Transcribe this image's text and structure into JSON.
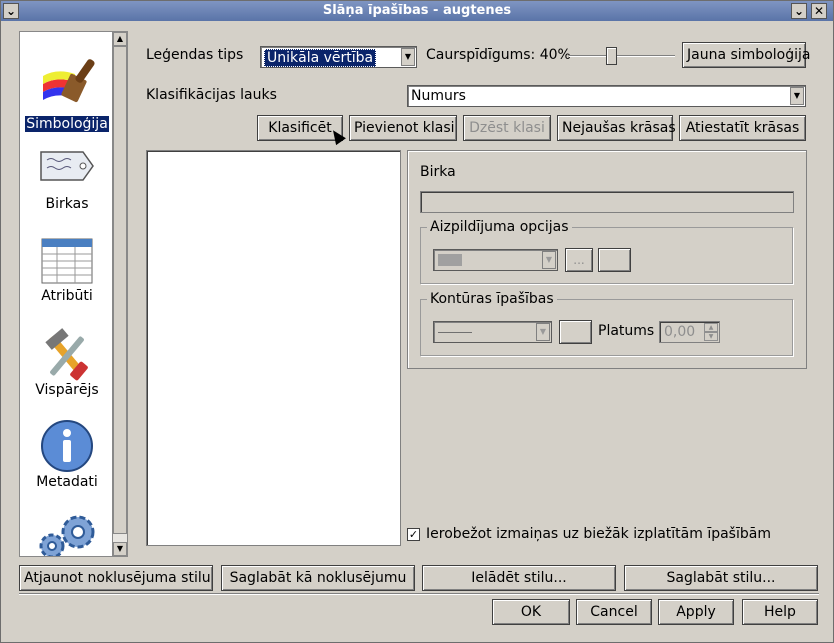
{
  "window": {
    "title": "Slāņa īpašības - augtenes",
    "menu_glyph": "⌄",
    "minimize_glyph": "⌄",
    "close_glyph": "✕"
  },
  "sidebar": {
    "items": [
      {
        "label": "Simboloģija",
        "icon": "paintbrush-icon",
        "selected": true
      },
      {
        "label": "Birkas",
        "icon": "label-tag-icon"
      },
      {
        "label": "Atribūti",
        "icon": "table-icon"
      },
      {
        "label": "Vispārējs",
        "icon": "tools-icon"
      },
      {
        "label": "Metadati",
        "icon": "info-icon"
      },
      {
        "label": "",
        "icon": "gears-icon"
      }
    ]
  },
  "symbology": {
    "legend_type_label": "Leģendas tips",
    "legend_type_value": "Unikāla vērtība",
    "transparency_label": "Caurspīdīgums: 40%",
    "transparency_percent": 40,
    "new_symbology_button": "Jauna simboloģija",
    "classification_field_label": "Klasifikācijas lauks",
    "classification_field_value": "Numurs",
    "buttons": {
      "classify": "Klasificēt",
      "add_class": "Pievienot klasi",
      "delete_class": "Dzēst klasi",
      "random_colors": "Nejaušas krāsas",
      "reset_colors": "Atiestatīt krāsas"
    },
    "label_heading": "Birka",
    "label_value": "",
    "fill_options_title": "Aizpildījuma opcijas",
    "fill_more_button": "...",
    "outline_title": "Kontūras īpašības",
    "width_label": "Platums",
    "width_value": "0,00",
    "restrict_checkbox_label": "Ierobežot izmaiņas uz biežāk izplatītām īpašībām",
    "restrict_checked": true,
    "check_glyph": "✓"
  },
  "style_buttons": {
    "restore_default": "Atjaunot noklusējuma stilu",
    "save_default": "Saglabāt kā noklusējumu",
    "load_style": "Ielādēt stilu...",
    "save_style": "Saglabāt stilu..."
  },
  "dialog_buttons": {
    "ok": "OK",
    "cancel": "Cancel",
    "apply": "Apply",
    "help": "Help"
  },
  "glyphs": {
    "drop_arrow": "▼",
    "up_arrow": "▲",
    "down_arrow": "▼"
  }
}
